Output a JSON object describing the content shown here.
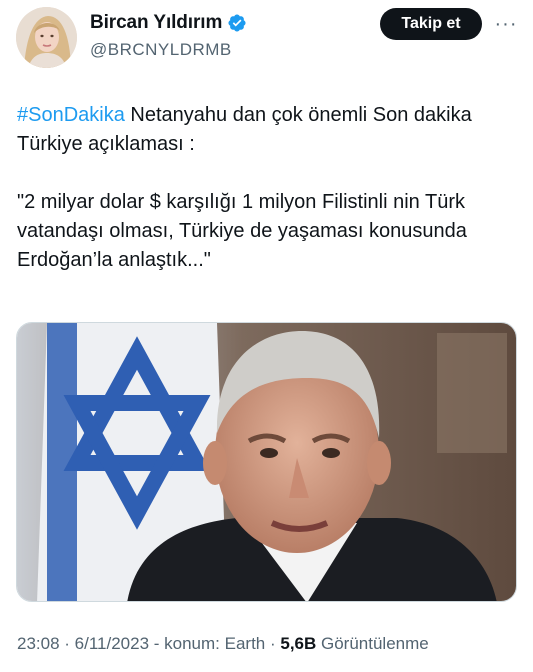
{
  "author": {
    "display_name": "Bircan Yıldırım",
    "handle": "@BRCNYLDRMB",
    "verified": true
  },
  "follow_button": {
    "label": "Takip et"
  },
  "more_button": {
    "label": "···"
  },
  "tweet": {
    "hashtag": "#SonDakika",
    "line1_rest": " Netanyahu dan çok önemli Son dakika Türkiye açıklaması :",
    "quote": "\"2 milyar dolar $ karşılığı 1 milyon Filistinli nin Türk vatandaşı olması, Türkiye de yaşaması konusunda Erdoğan’la anlaştık...\""
  },
  "footer": {
    "time": "23:08",
    "sep1": " · ",
    "date": "6/11/2023",
    "sep2": " - ",
    "location": "konum: Earth",
    "sep3": " · ",
    "views_count": "5,6B",
    "views_label": " Görüntülenme"
  },
  "colors": {
    "link": "#1d9bf0",
    "verified_badge": "#1d9bf0",
    "text": "#0f1419",
    "secondary_text": "#536471",
    "button_bg": "#0f1419",
    "flag_blue": "#2f5fb3"
  },
  "icons": {
    "verified": "verified-badge-icon",
    "more": "more-horizontal-icon"
  }
}
